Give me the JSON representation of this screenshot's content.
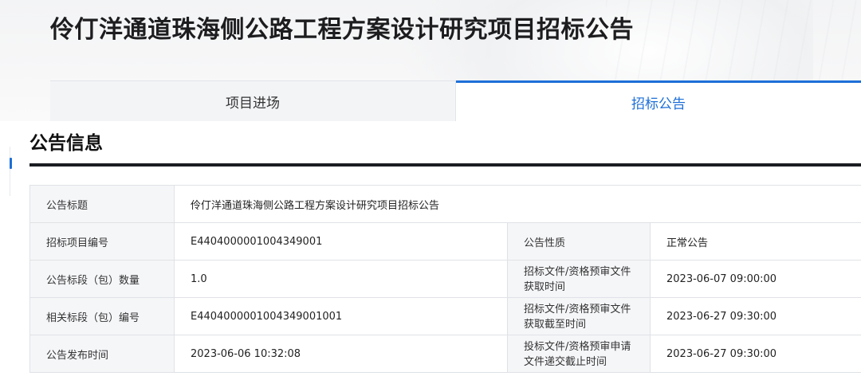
{
  "header": {
    "title": "伶仃洋通道珠海侧公路工程方案设计研究项目招标公告"
  },
  "tabs": [
    {
      "label": "项目进场",
      "active": false
    },
    {
      "label": "招标公告",
      "active": true
    }
  ],
  "section": {
    "title": "公告信息"
  },
  "info": {
    "announcement_title_label": "公告标题",
    "announcement_title_value": "伶仃洋通道珠海侧公路工程方案设计研究项目招标公告",
    "project_no_label": "招标项目编号",
    "project_no_value": "E4404000001004349001",
    "nature_label": "公告性质",
    "nature_value": "正常公告",
    "lot_count_label": "公告标段（包）数量",
    "lot_count_value": "1.0",
    "doc_get_time_label_1": "招标文件/资格预审文件",
    "doc_get_time_label_2": "获取时间",
    "doc_get_time_value": "2023-06-07 09:00:00",
    "related_lot_label": "相关标段（包）编号",
    "related_lot_value": "E4404000001004349001001",
    "doc_deadline_label_1": "招标文件/资格预审文件",
    "doc_deadline_label_2": "获取截至时间",
    "doc_deadline_value": "2023-06-27 09:30:00",
    "publish_time_label": "公告发布时间",
    "publish_time_value": "2023-06-06 10:32:08",
    "submit_deadline_label_1": "投标文件/资格预审申请",
    "submit_deadline_label_2": "文件递交截止时间",
    "submit_deadline_value": "2023-06-27 09:30:00"
  },
  "colors": {
    "accent": "#1d6fd8",
    "rule": "#1a1d22",
    "label_bg": "#f5f6f8",
    "border": "#dfe2e6"
  }
}
